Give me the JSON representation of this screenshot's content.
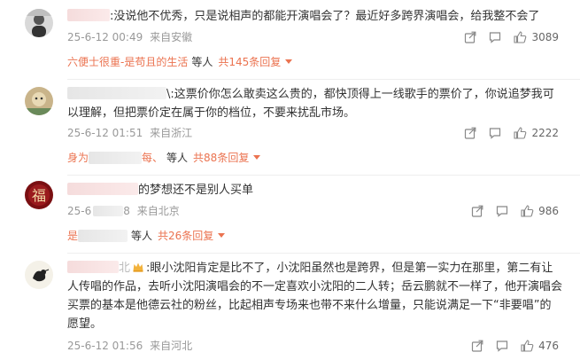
{
  "comments": [
    {
      "text": ":没说他不优秀，只是说相声的都能开演唱会了？最近好多跨界演唱会，给我整不会了",
      "time": "25-6-12 00:49",
      "location": "来自安徽",
      "likes": "3089",
      "reply": {
        "name": "六便士很重-是苟且的生活",
        "etc": "等人",
        "total": "共145条回复"
      }
    },
    {
      "text": "\\:这票价你怎么敢卖这么贵的，都快顶得上一线歌手的票价了，你说追梦我可以理解，但把票价定在属于你的档位，不要来扰乱市场。",
      "time": "25-6-12 01:51",
      "location": "来自浙江",
      "likes": "2222",
      "reply": {
        "name": "身为",
        "name_tail": "每、",
        "etc": "等人",
        "total": "共88条回复"
      }
    },
    {
      "text": "的梦想还不是别人买单",
      "time": "25-6",
      "time_tail": "8",
      "location": "来自北京",
      "likes": "986",
      "reply": {
        "name": "是",
        "etc": "等人",
        "total": "共26条回复"
      }
    },
    {
      "text_head": "北",
      "text": ":眼小沈阳肯定是比不了，小沈阳虽然也是跨界，但是第一实力在那里，第二有让人传唱的作品，去听小沈阳演唱会的不一定喜欢小沈阳的二人转；岳云鹏就不一样了，他开演唱会买票的基本是他德云社的粉丝，比起相声专场来也带不来什么增量，只能说满足一下“非要唱”的愿望。",
      "time": "25-6-12 01:56",
      "location": "来自河北",
      "likes": "476"
    }
  ],
  "icons": {
    "share": "share-icon",
    "comment": "comment-icon",
    "like": "thumbs-up-icon",
    "badge": "crown-badge-icon"
  },
  "colors": {
    "link": "#eb7350",
    "meta": "#999999",
    "text": "#333333"
  }
}
